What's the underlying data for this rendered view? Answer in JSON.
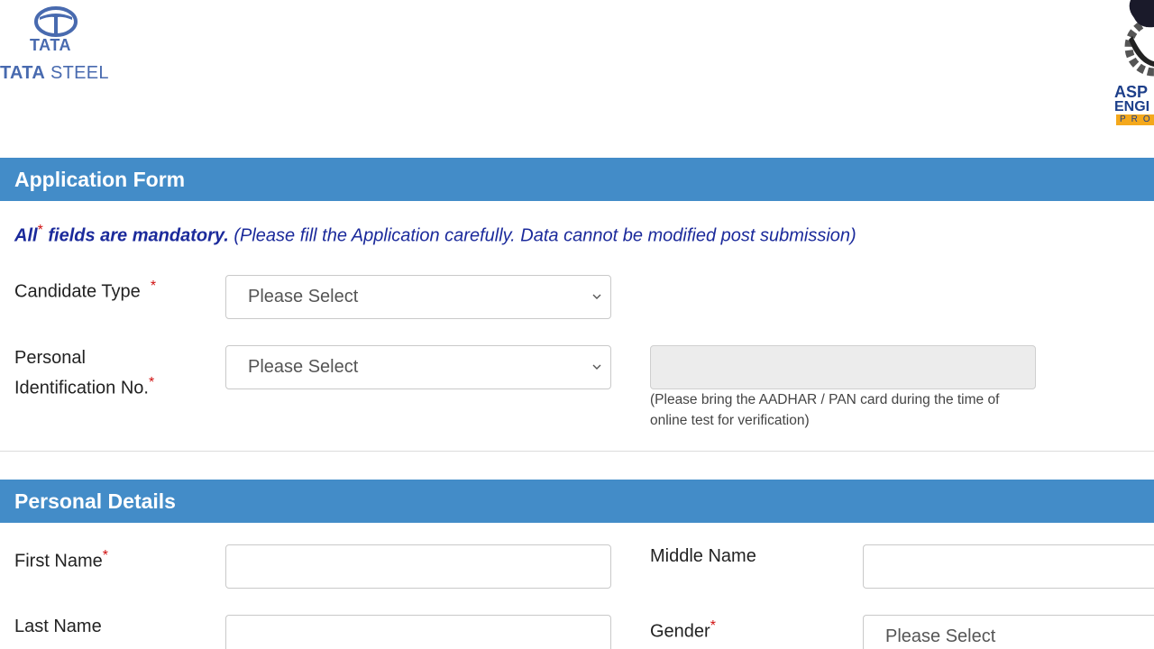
{
  "header": {
    "tata_logo_word": "TATA",
    "tata_steel_prefix": "TATA",
    "tata_steel_suffix": "STEEL",
    "partner_line1": "ASP",
    "partner_line2": "ENGI",
    "partner_line3": "PRO"
  },
  "application_form": {
    "title": "Application Form",
    "notice_prefix": "All",
    "notice_star": "*",
    "notice_bold": " fields are mandatory.",
    "notice_rest": " (Please fill the Application carefully. Data cannot be modified post submission)",
    "candidate_type": {
      "label": "Candidate Type",
      "required_mark": "*",
      "value": "Please Select"
    },
    "pin": {
      "label_line1": "Personal",
      "label_line2": "Identification No.",
      "required_mark": "*",
      "value": "Please Select",
      "hint": "(Please bring the AADHAR / PAN card during the time of online test for verification)"
    }
  },
  "personal_details": {
    "title": "Personal Details",
    "first_name": {
      "label": "First Name",
      "required_mark": "*",
      "value": ""
    },
    "middle_name": {
      "label": "Middle Name",
      "value": ""
    },
    "last_name": {
      "label": "Last Name",
      "value": ""
    },
    "gender": {
      "label": "Gender",
      "required_mark": "*",
      "value": "Please Select"
    }
  },
  "colors": {
    "section_bar": "#438cc8",
    "notice_text": "#1b2a9b",
    "required": "#d01010",
    "brand_blue": "#486aaf",
    "partner_orange": "#f4a81c"
  }
}
